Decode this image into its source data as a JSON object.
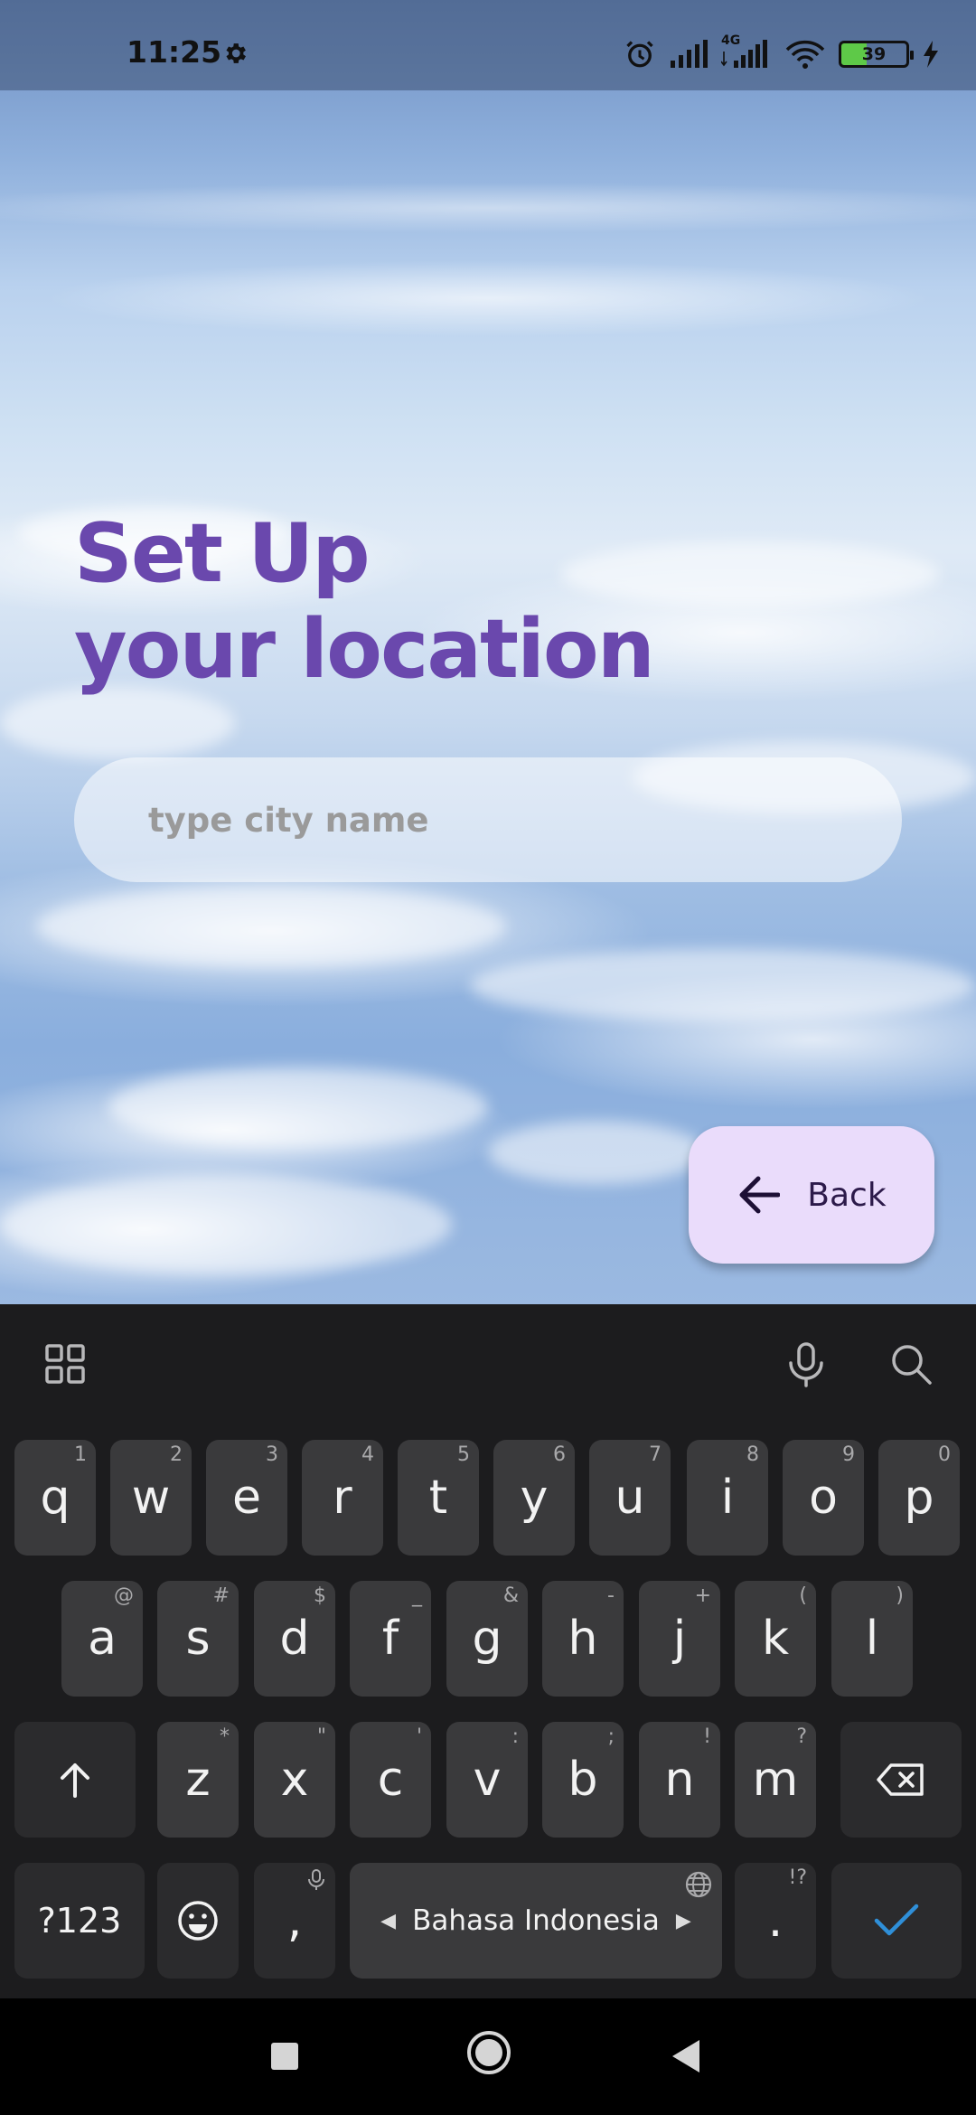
{
  "status_bar": {
    "time": "11:25",
    "network_label": "4G",
    "battery": "39",
    "icons": [
      "gear-icon",
      "alarm-icon",
      "signal-icon",
      "signal-4g-icon",
      "wifi-icon",
      "battery-icon",
      "charging-icon"
    ]
  },
  "screen": {
    "title_line1": "Set Up",
    "title_line2": "your location",
    "city_placeholder": "type city name",
    "city_value": "",
    "back_label": "Back",
    "title_color": "#6a48ad",
    "back_bg_color": "#eadcfb"
  },
  "keyboard": {
    "row1": [
      {
        "key": "q",
        "hint": "1"
      },
      {
        "key": "w",
        "hint": "2"
      },
      {
        "key": "e",
        "hint": "3"
      },
      {
        "key": "r",
        "hint": "4"
      },
      {
        "key": "t",
        "hint": "5"
      },
      {
        "key": "y",
        "hint": "6"
      },
      {
        "key": "u",
        "hint": "7"
      },
      {
        "key": "i",
        "hint": "8"
      },
      {
        "key": "o",
        "hint": "9"
      },
      {
        "key": "p",
        "hint": "0"
      }
    ],
    "row2": [
      {
        "key": "a",
        "hint": "@"
      },
      {
        "key": "s",
        "hint": "#"
      },
      {
        "key": "d",
        "hint": "$"
      },
      {
        "key": "f",
        "hint": "_"
      },
      {
        "key": "g",
        "hint": "&"
      },
      {
        "key": "h",
        "hint": "-"
      },
      {
        "key": "j",
        "hint": "+"
      },
      {
        "key": "k",
        "hint": "("
      },
      {
        "key": "l",
        "hint": ")"
      }
    ],
    "row3": [
      {
        "key": "z",
        "hint": "*"
      },
      {
        "key": "x",
        "hint": "\""
      },
      {
        "key": "c",
        "hint": "'"
      },
      {
        "key": "v",
        "hint": ":"
      },
      {
        "key": "b",
        "hint": ";"
      },
      {
        "key": "n",
        "hint": "!"
      },
      {
        "key": "m",
        "hint": "?"
      }
    ],
    "symbols_key": "?123",
    "comma_key": ",",
    "space_label": "Bahasa Indonesia",
    "period_key": ".",
    "period_hint": "!?",
    "accent_color": "#2f8fd8"
  }
}
